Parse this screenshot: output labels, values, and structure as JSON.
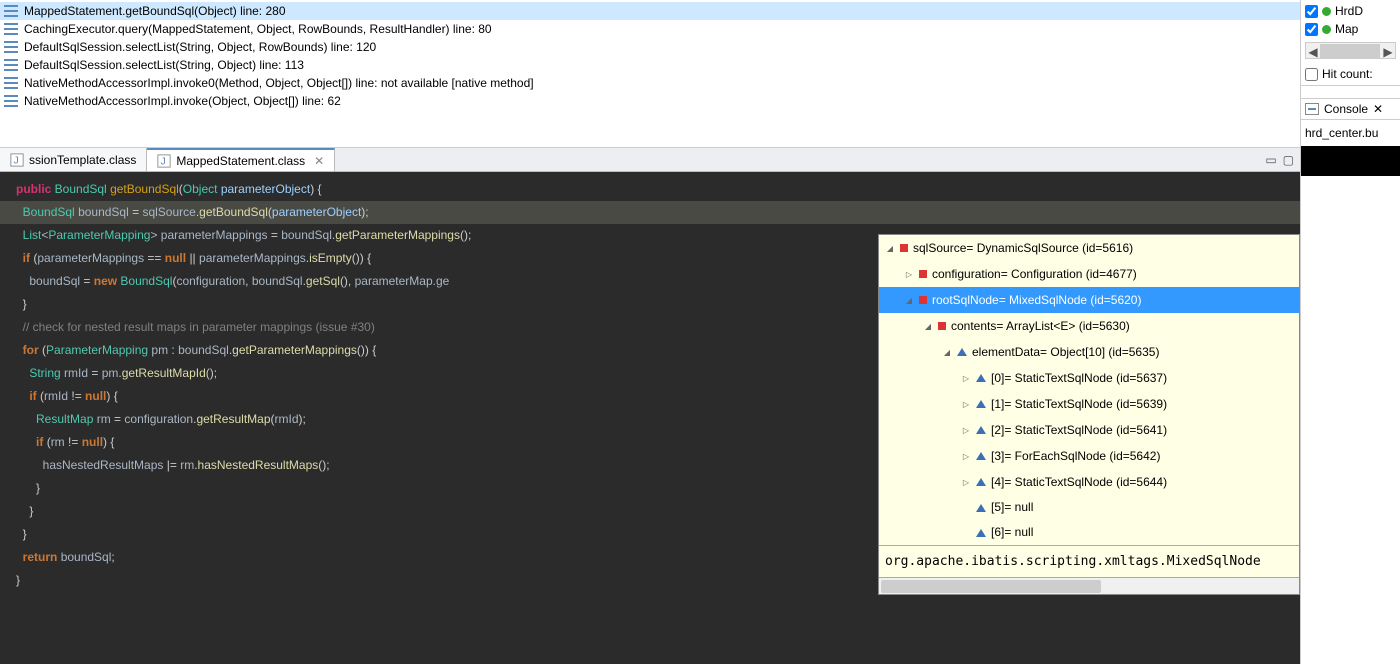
{
  "stack": [
    {
      "text": "MappedStatement.getBoundSql(Object) line: 280",
      "selected": true
    },
    {
      "text": "CachingExecutor.query(MappedStatement, Object, RowBounds, ResultHandler) line: 80"
    },
    {
      "text": "DefaultSqlSession.selectList(String, Object, RowBounds) line: 120"
    },
    {
      "text": "DefaultSqlSession.selectList(String, Object) line: 113"
    },
    {
      "text": "NativeMethodAccessorImpl.invoke0(Method, Object, Object[]) line: not available [native method]"
    },
    {
      "text": "NativeMethodAccessorImpl.invoke(Object, Object[]) line: 62"
    }
  ],
  "tabs": [
    {
      "label": "ssionTemplate.class",
      "active": false
    },
    {
      "label": "MappedStatement.class",
      "active": true
    }
  ],
  "code": {
    "l1": {
      "a": "public ",
      "b": "BoundSql ",
      "c": "getBoundSql",
      "d": "(",
      "e": "Object ",
      "f": "parameterObject",
      "g": ") {"
    },
    "l2": {
      "a": "  ",
      "b": "BoundSql ",
      "c": "boundSql ",
      "d": "= ",
      "e": "sqlSource",
      "f": ".",
      "g": "getBoundSql",
      "h": "(",
      "i": "parameterObject",
      "j": ");"
    },
    "l3": {
      "a": "  ",
      "b": "List",
      "c": "<",
      "d": "ParameterMapping",
      "e": "> ",
      "f": "parameterMappings ",
      "g": "= ",
      "h": "boundSql",
      "i": ".",
      "j": "getParameterMappings",
      "k": "();"
    },
    "l4": {
      "a": "  ",
      "b": "if ",
      "c": "(",
      "d": "parameterMappings ",
      "e": "== ",
      "f": "null ",
      "g": "|| ",
      "h": "parameterMappings",
      "i": ".",
      "j": "isEmpty",
      "k": "()) {"
    },
    "l5": {
      "a": "    ",
      "b": "boundSql ",
      "c": "= ",
      "d": "new ",
      "e": "BoundSql",
      "f": "(",
      "g": "configuration",
      "h": ", ",
      "i": "boundSql",
      "j": ".",
      "k": "getSql",
      "l": "(), ",
      "m": "parameterMap",
      "n": ".ge"
    },
    "l6": "  }",
    "l7": "",
    "l8": "  // check for nested result maps in parameter mappings (issue #30)",
    "l9": {
      "a": "  ",
      "b": "for ",
      "c": "(",
      "d": "ParameterMapping ",
      "e": "pm ",
      "f": ": ",
      "g": "boundSql",
      "h": ".",
      "i": "getParameterMappings",
      "j": "()) {"
    },
    "l10": {
      "a": "    ",
      "b": "String ",
      "c": "rmId ",
      "d": "= ",
      "e": "pm",
      "f": ".",
      "g": "getResultMapId",
      "h": "();"
    },
    "l11": {
      "a": "    ",
      "b": "if ",
      "c": "(",
      "d": "rmId ",
      "e": "!= ",
      "f": "null",
      "g": ") {"
    },
    "l12": {
      "a": "      ",
      "b": "ResultMap ",
      "c": "rm ",
      "d": "= ",
      "e": "configuration",
      "f": ".",
      "g": "getResultMap",
      "h": "(",
      "i": "rmId",
      "j": ");"
    },
    "l13": {
      "a": "      ",
      "b": "if ",
      "c": "(",
      "d": "rm ",
      "e": "!= ",
      "f": "null",
      "g": ") {"
    },
    "l14": {
      "a": "        ",
      "b": "hasNestedResultMaps ",
      "c": "|= ",
      "d": "rm",
      "e": ".",
      "f": "hasNestedResultMaps",
      "g": "();"
    },
    "l15": "      }",
    "l16": "    }",
    "l17": "  }",
    "l18": "",
    "l19": {
      "a": "  ",
      "b": "return ",
      "c": "boundSql",
      "d": ";"
    },
    "l20": "}"
  },
  "debug": {
    "rows": [
      {
        "depth": 0,
        "arrow": "open",
        "icon": "sq",
        "text": "sqlSource= DynamicSqlSource  (id=5616)"
      },
      {
        "depth": 1,
        "arrow": "closed",
        "icon": "sq",
        "text": "configuration= Configuration  (id=4677)"
      },
      {
        "depth": 1,
        "arrow": "open",
        "icon": "sq",
        "text": "rootSqlNode= MixedSqlNode  (id=5620)",
        "selected": true
      },
      {
        "depth": 2,
        "arrow": "open",
        "icon": "sq",
        "text": "contents= ArrayList<E>  (id=5630)"
      },
      {
        "depth": 3,
        "arrow": "open",
        "icon": "tri",
        "text": "elementData= Object[10]  (id=5635)"
      },
      {
        "depth": 4,
        "arrow": "closed",
        "icon": "tri",
        "text": "[0]= StaticTextSqlNode  (id=5637)"
      },
      {
        "depth": 4,
        "arrow": "closed",
        "icon": "tri",
        "text": "[1]= StaticTextSqlNode  (id=5639)"
      },
      {
        "depth": 4,
        "arrow": "closed",
        "icon": "tri",
        "text": "[2]= StaticTextSqlNode  (id=5641)"
      },
      {
        "depth": 4,
        "arrow": "closed",
        "icon": "tri",
        "text": "[3]= ForEachSqlNode  (id=5642)"
      },
      {
        "depth": 4,
        "arrow": "closed",
        "icon": "tri",
        "text": "[4]= StaticTextSqlNode  (id=5644)"
      },
      {
        "depth": 4,
        "arrow": "",
        "icon": "tri",
        "text": "[5]= null"
      },
      {
        "depth": 4,
        "arrow": "",
        "icon": "tri",
        "text": "[6]= null"
      }
    ],
    "qname": "org.apache.ibatis.scripting.xmltags.MixedSqlNode"
  },
  "right": {
    "bp1": "HrdD",
    "bp2": "Map",
    "hitcount": "Hit count:",
    "console": "Console",
    "console_close": "✕",
    "hrd": "hrd_center.bu"
  }
}
